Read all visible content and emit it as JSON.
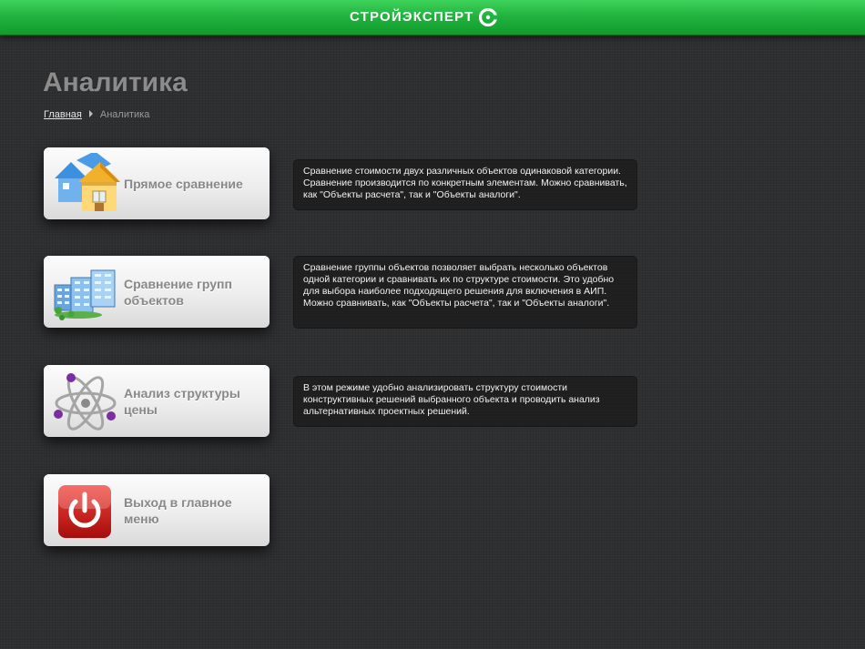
{
  "header": {
    "brand": "СТРОЙЭКСПЕРТ",
    "brand_color": "#22b43f"
  },
  "page": {
    "title": "Аналитика"
  },
  "breadcrumb": {
    "home": "Главная",
    "current": "Аналитика"
  },
  "menu": [
    {
      "label": "Прямое сравнение",
      "icon": "houses-icon",
      "description": "Сравнение стоимости двух различных объектов одинаковой категории. Сравнение производится по конкретным элементам. Можно сравнивать, как \"Объекты расчета\", так и \"Объекты аналоги\"."
    },
    {
      "label": "Сравнение групп объектов",
      "icon": "buildings-icon",
      "description": "Сравнение группы объектов позволяет выбрать несколько объектов одной категории и сравнивать их по структуре стоимости. Это удобно для выбора наиболее подходящего решения для включения в АИП. Можно сравнивать, как \"Объекты расчета\", так и \"Объекты аналоги\"."
    },
    {
      "label": "Анализ структуры цены",
      "icon": "atom-icon",
      "description": "В этом режиме удобно анализировать структуру стоимости конструктивных решений выбранного объекта и проводить анализ альтернативных проектных решений."
    },
    {
      "label": "Выход в главное меню",
      "icon": "power-icon"
    }
  ]
}
